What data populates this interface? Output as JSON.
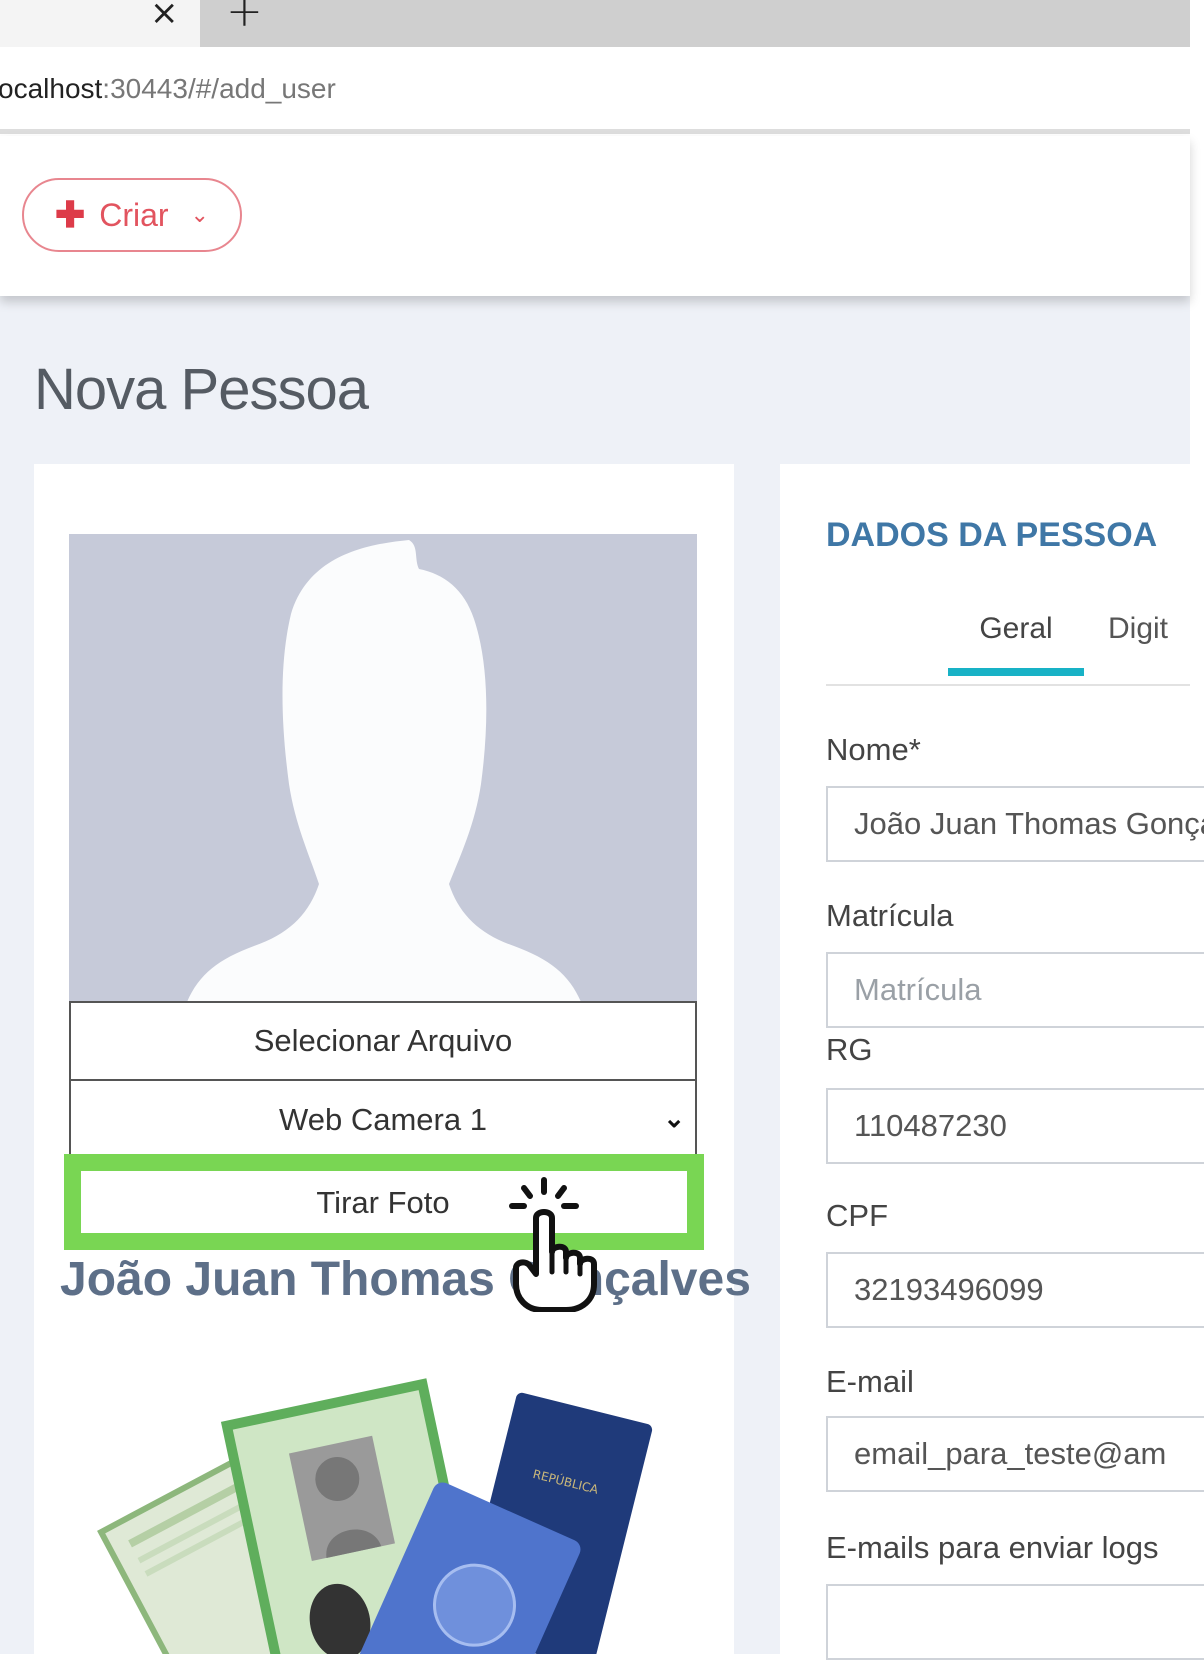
{
  "browser": {
    "tab_close_glyph": "×",
    "new_tab_glyph": "+",
    "url_host": "ocalhost",
    "url_path": ":30443/#/add_user"
  },
  "header": {
    "create_button": {
      "icon": "plus-icon",
      "label": "Criar",
      "chevron": "chevron-down-icon"
    }
  },
  "page": {
    "title": "Nova Pessoa"
  },
  "photo_panel": {
    "select_file_label": "Selecionar Arquivo",
    "camera_selected": "Web Camera 1",
    "take_photo_label": "Tirar Foto",
    "person_name": "João Juan Thomas Gonçalves",
    "highlight_color": "#79d653"
  },
  "person_data": {
    "section_title": "DADOS DA PESSOA",
    "tabs": [
      {
        "label": "Geral",
        "active": true
      },
      {
        "label": "Digit",
        "active": false
      }
    ],
    "fields": {
      "nome": {
        "label": "Nome*",
        "value": "João Juan Thomas Gonçalves"
      },
      "matricula": {
        "label": "Matrícula",
        "placeholder": "Matrícula",
        "value": ""
      },
      "rg": {
        "label": "RG",
        "value": "110487230"
      },
      "cpf": {
        "label": "CPF",
        "value": "32193496099"
      },
      "email": {
        "label": "E-mail",
        "value": "email_para_teste@am"
      },
      "log_emails": {
        "label": "E-mails para enviar logs"
      }
    },
    "accent_color": "#3f77a6",
    "tab_underline_color": "#18b2c6"
  }
}
